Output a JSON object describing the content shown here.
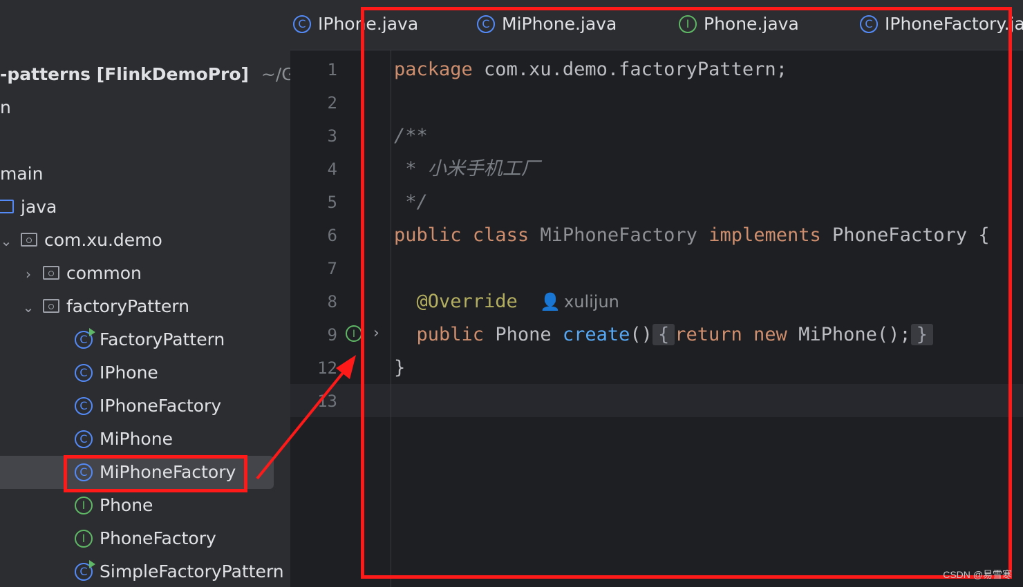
{
  "tabs": [
    {
      "label": "IPhone.java",
      "icon": "class-icon"
    },
    {
      "label": "MiPhone.java",
      "icon": "class-icon"
    },
    {
      "label": "Phone.java",
      "icon": "interface-icon"
    },
    {
      "label": "IPhoneFactory.ja",
      "icon": "class-icon"
    }
  ],
  "tree": {
    "project_name": "-patterns [FlinkDemoPro]",
    "project_path": "~/Git(",
    "src_stub": "n",
    "main": "main",
    "java": "java",
    "package": "com.xu.demo",
    "common": "common",
    "factory_pkg": "factoryPattern",
    "items": [
      {
        "label": "FactoryPattern",
        "icon": "runnable-class-icon"
      },
      {
        "label": "IPhone",
        "icon": "class-icon"
      },
      {
        "label": "IPhoneFactory",
        "icon": "class-icon"
      },
      {
        "label": "MiPhone",
        "icon": "class-icon"
      },
      {
        "label": "MiPhoneFactory",
        "icon": "class-icon",
        "selected": true
      },
      {
        "label": "Phone",
        "icon": "interface-icon"
      },
      {
        "label": "PhoneFactory",
        "icon": "interface-icon"
      },
      {
        "label": "SimpleFactoryPattern",
        "icon": "runnable-class-icon"
      }
    ]
  },
  "editor": {
    "line_numbers": [
      "1",
      "2",
      "3",
      "4",
      "5",
      "6",
      "7",
      "8",
      "9",
      "12",
      "13"
    ],
    "line1_kw": "package",
    "line1_rest": " com.xu.demo.factoryPattern;",
    "line3": "/**",
    "line4": " * 小米手机工厂",
    "line5": " */",
    "line6_kw1": "public",
    "line6_kw2": "class",
    "line6_name": "MiPhoneFactory",
    "line6_kw3": "implements",
    "line6_iface": "PhoneFactory",
    "line6_brace": "{",
    "line8_annotation": "@Override",
    "line8_author": "xulijun",
    "line9_kw": "public",
    "line9_type": "Phone",
    "line9_method": "create",
    "line9_parens": "()",
    "line9_open": "{",
    "line9_return": "return",
    "line9_new": "new",
    "line9_expr": "MiPhone();",
    "line9_close": "}",
    "line12": "}"
  },
  "colors": {
    "annotation_red": "#ff1a1a",
    "keyword": "#cf8e6d",
    "method": "#56a8f5"
  },
  "watermark": "CSDN @易雪寒"
}
